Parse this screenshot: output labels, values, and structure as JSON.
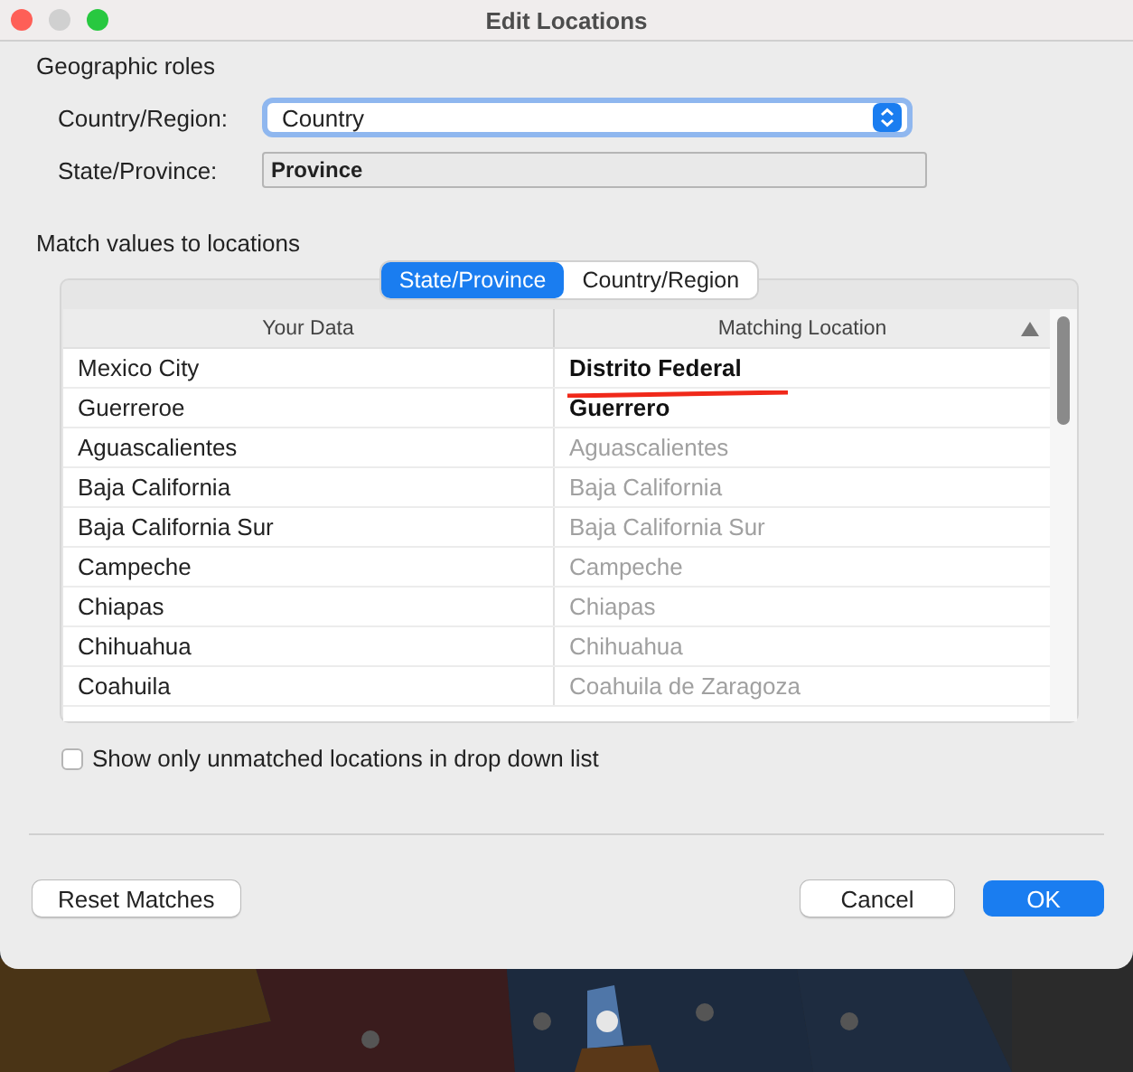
{
  "window": {
    "title": "Edit Locations"
  },
  "geographic_roles": {
    "heading": "Geographic roles",
    "fields": [
      {
        "kind": "dropdown",
        "label": "Country/Region:",
        "value": "Country",
        "focused": true
      },
      {
        "kind": "readonly",
        "label": "State/Province:",
        "value": "Province"
      }
    ]
  },
  "match": {
    "heading": "Match values to locations",
    "tabs": [
      {
        "label": "State/Province",
        "selected": true
      },
      {
        "label": "Country/Region",
        "selected": false
      }
    ],
    "columns": [
      {
        "label": "Your Data",
        "sorted": false
      },
      {
        "label": "Matching Location",
        "sorted": true
      }
    ],
    "rows": [
      {
        "data": "Mexico City",
        "location": "Distrito Federal",
        "kind": "edited",
        "underlined": true
      },
      {
        "data": "Guerreroe",
        "location": "Guerrero",
        "kind": "edited",
        "underlined": false
      },
      {
        "data": "Aguascalientes",
        "location": "Aguascalientes",
        "kind": "auto",
        "underlined": false
      },
      {
        "data": "Baja California",
        "location": "Baja California",
        "kind": "auto",
        "underlined": false
      },
      {
        "data": "Baja California Sur",
        "location": "Baja California Sur",
        "kind": "auto",
        "underlined": false
      },
      {
        "data": "Campeche",
        "location": "Campeche",
        "kind": "auto",
        "underlined": false
      },
      {
        "data": "Chiapas",
        "location": "Chiapas",
        "kind": "auto",
        "underlined": false
      },
      {
        "data": "Chihuahua",
        "location": "Chihuahua",
        "kind": "auto",
        "underlined": false
      },
      {
        "data": "Coahuila",
        "location": "Coahuila de Zaragoza",
        "kind": "auto",
        "underlined": false
      }
    ],
    "checkbox": {
      "label": "Show only unmatched locations in drop down list",
      "checked": false
    }
  },
  "left_buttons": [
    {
      "label": "Reset Matches",
      "kind": "secondary"
    }
  ],
  "right_buttons": [
    {
      "label": "Cancel",
      "kind": "secondary"
    },
    {
      "label": "OK",
      "kind": "primary"
    }
  ]
}
